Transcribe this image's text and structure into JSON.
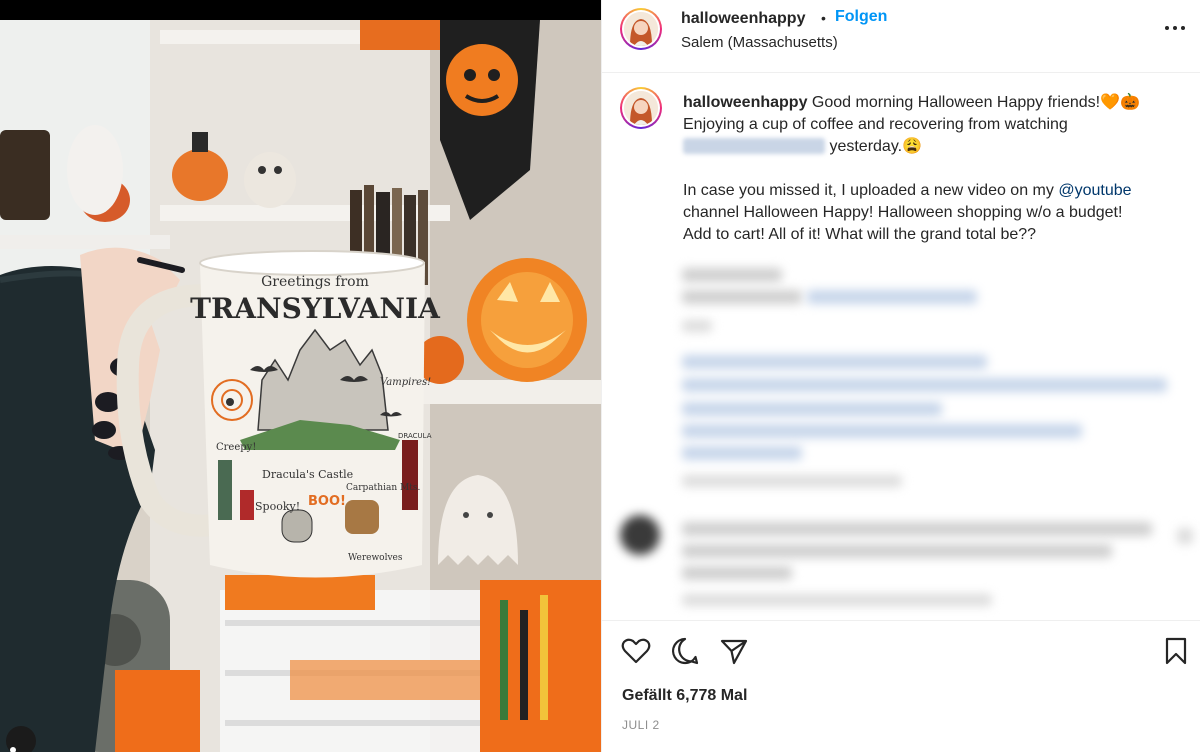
{
  "photo": {
    "mug": {
      "line1": "Greetings from",
      "line2": "TRANSYLVANIA",
      "labels": [
        "Vampires!",
        "Creepy!",
        "Dracula's Castle",
        "Carpathian Mts.",
        "Spooky!",
        "BOO!",
        "Werewolves",
        "DRACULA"
      ]
    }
  },
  "header": {
    "username": "halloweenhappy",
    "dot": "•",
    "follow_label": "Folgen",
    "location": "Salem (Massachusetts)",
    "more_icon": "more-horizontal-icon"
  },
  "caption": {
    "username": "halloweenhappy",
    "line1": "Good morning Halloween Happy friends!🧡🎃",
    "line2": "Enjoying a cup of coffee and recovering from watching",
    "line3": "yesterday.😩",
    "para2_a": "In case you missed it, I uploaded a new video on my ",
    "para2_mention": "@youtube",
    "para2_b": "channel Halloween Happy! Halloween shopping w/o a budget!",
    "para2_c": "Add to cart! All of it! What will the grand total be??"
  },
  "actions": {
    "like_icon": "heart-icon",
    "comment_icon": "comment-icon",
    "share_icon": "send-icon",
    "save_icon": "bookmark-icon",
    "likes_text": "Gefällt 6,778 Mal",
    "date": "JULI 2"
  },
  "colors": {
    "accent": "#0095f6",
    "mention": "#00376b",
    "text": "#262626",
    "muted": "#8e8e8e"
  }
}
